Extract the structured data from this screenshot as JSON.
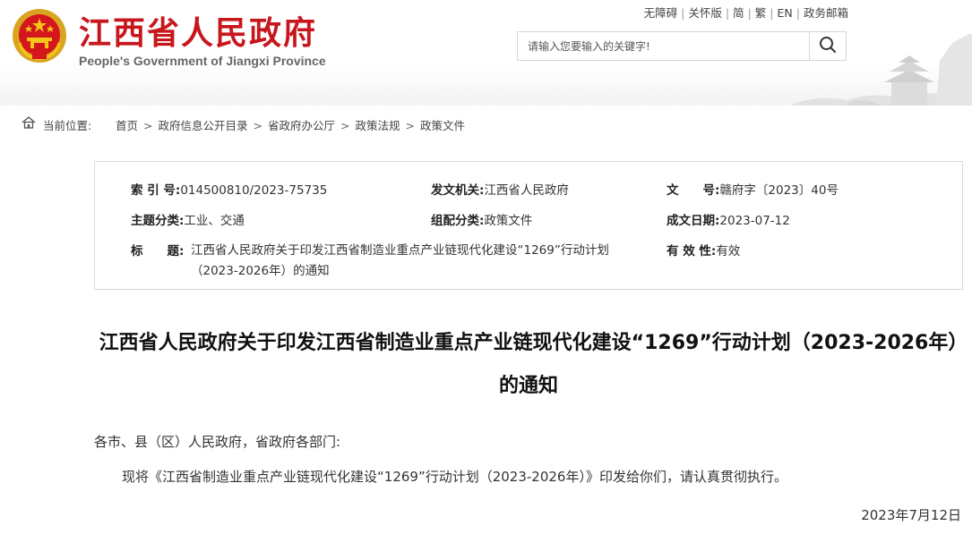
{
  "header": {
    "site_title": "江西省人民政府",
    "site_subtitle": "People's Government of Jiangxi Province",
    "top_links": [
      "无障碍",
      "关怀版",
      "简",
      "繁",
      "EN",
      "政务邮箱"
    ],
    "search": {
      "placeholder": "请输入您要输入的关键字!"
    }
  },
  "breadcrumb": {
    "label": "当前位置:",
    "items": [
      "首页",
      "政府信息公开目录",
      "省政府办公厅",
      "政策法规",
      "政策文件"
    ]
  },
  "meta": {
    "index_no": {
      "key": "索 引 号:",
      "value": "014500810/2023-75735"
    },
    "issuer": {
      "key": "发文机关:",
      "value": "江西省人民政府"
    },
    "doc_no": {
      "key": "文　　号:",
      "value": "赣府字〔2023〕40号"
    },
    "theme": {
      "key": "主题分类:",
      "value": "工业、交通"
    },
    "category": {
      "key": "组配分类:",
      "value": "政策文件"
    },
    "date": {
      "key": "成文日期:",
      "value": "2023-07-12"
    },
    "title": {
      "key": "标　　题:",
      "value": "江西省人民政府关于印发江西省制造业重点产业链现代化建设“1269”行动计划（2023-2026年）的通知"
    },
    "validity": {
      "key": "有 效 性:",
      "value": "有效"
    }
  },
  "document": {
    "title": "江西省人民政府关于印发江西省制造业重点产业链现代化建设“1269”行动计划（2023-2026年）的通知",
    "salutation": "各市、县（区）人民政府，省政府各部门:",
    "body": "现将《江西省制造业重点产业链现代化建设“1269”行动计划（2023-2026年）》印发给你们，请认真贯彻执行。",
    "date": "2023年7月12日"
  }
}
